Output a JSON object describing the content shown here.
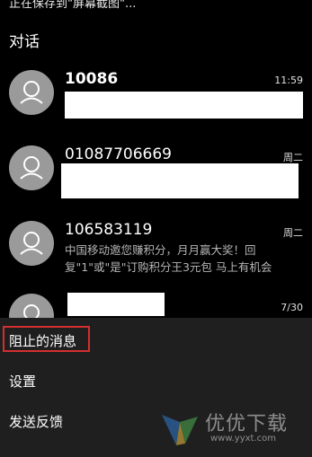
{
  "status": {
    "text": "正在保存到\"屏幕截图\"..."
  },
  "page": {
    "title": "对话"
  },
  "conversations": [
    {
      "name": "10086",
      "time": "11:59",
      "preview": ""
    },
    {
      "name": "01087706669",
      "time": "周二",
      "preview": ""
    },
    {
      "name": "106583119",
      "time": "周二",
      "preview": "中国移动邀您赚积分，月月赢大奖！回复\"1\"或\"是\"订购积分王3元包 马上有机会"
    },
    {
      "name": "",
      "time": "7/30",
      "preview": ""
    }
  ],
  "menu": {
    "blocked": "阻止的消息",
    "settings": "设置",
    "feedback": "发送反馈"
  },
  "watermark": {
    "text": "优优下载",
    "url": "www.yyxt.com"
  },
  "colors": {
    "highlight": "#d32f2f",
    "menu_bg": "#1f1f1f",
    "avatar": "#9a9a9a"
  }
}
